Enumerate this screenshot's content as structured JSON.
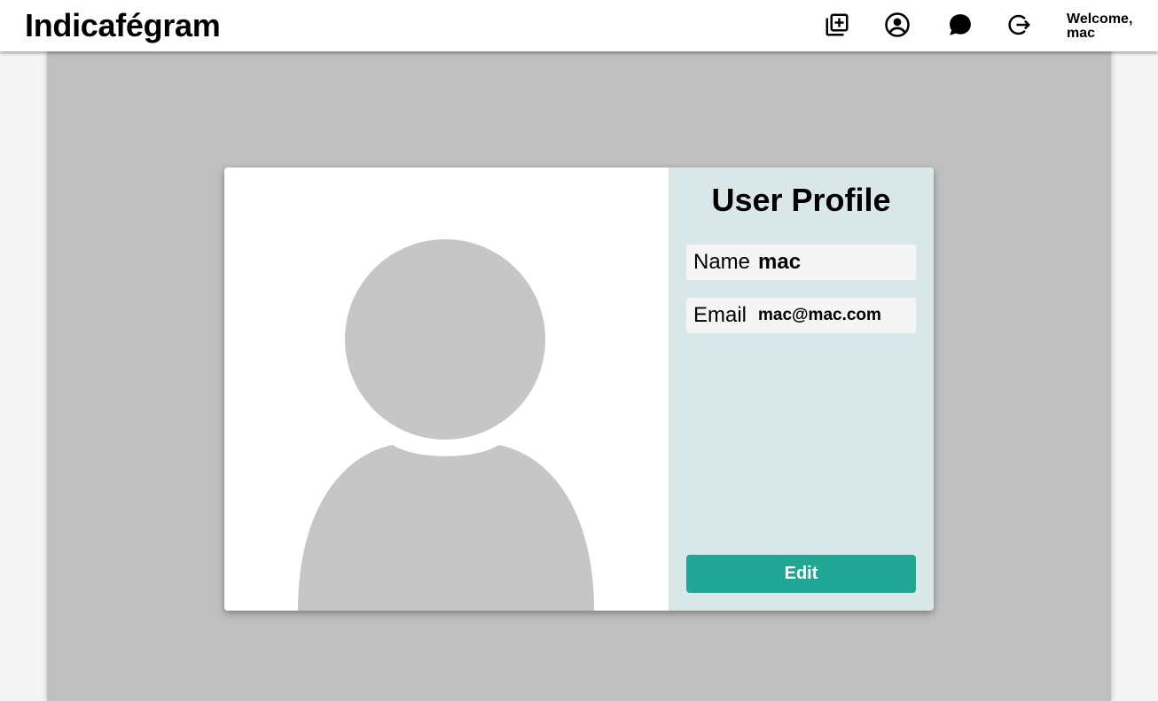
{
  "header": {
    "brand": "Indicafégram",
    "icons": [
      "add-post-icon",
      "profile-icon",
      "chat-icon",
      "logout-icon"
    ],
    "welcome_line1": "Welcome,",
    "welcome_line2": "mac"
  },
  "profile": {
    "title": "User Profile",
    "avatar": "default-user-avatar",
    "fields": [
      {
        "label": "Name",
        "value": "mac"
      },
      {
        "label": "Email",
        "value": "mac@mac.com"
      }
    ],
    "edit_label": "Edit"
  },
  "colors": {
    "accent": "#21a693",
    "info_pane": "#dae7e8",
    "backdrop": "#bfbfbf",
    "avatar": "#c6c6c6"
  }
}
